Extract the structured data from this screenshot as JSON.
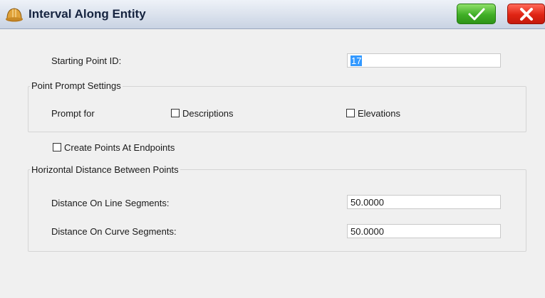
{
  "window": {
    "title": "Interval Along Entity",
    "icon": "hard-hat-icon",
    "accent_ok": "#3fae26",
    "accent_cancel": "#e02414"
  },
  "starting_point": {
    "label": "Starting Point ID:",
    "value": "17"
  },
  "point_prompt": {
    "group_title": "Point Prompt Settings",
    "prompt_label": "Prompt for",
    "descriptions": {
      "label": "Descriptions",
      "checked": false
    },
    "elevations": {
      "label": "Elevations",
      "checked": false
    }
  },
  "create_endpoints": {
    "label": "Create Points At Endpoints",
    "checked": false
  },
  "horizontal_distance": {
    "group_title": "Horizontal Distance Between Points",
    "line_label": "Distance On Line Segments:",
    "line_value": "50.0000",
    "curve_label": "Distance On Curve Segments:",
    "curve_value": "50.0000"
  }
}
